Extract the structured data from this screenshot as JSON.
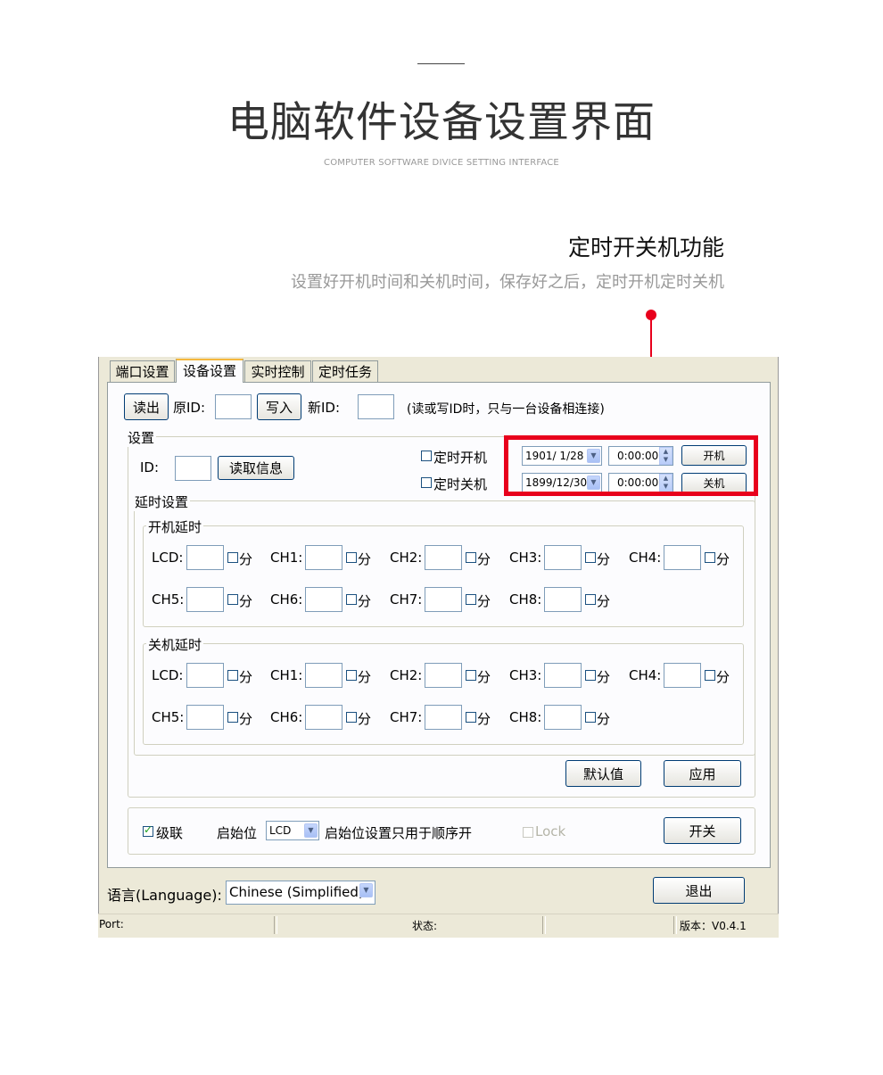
{
  "page": {
    "title": "电脑软件设备设置界面",
    "subtitle": "COMPUTER SOFTWARE DIVICE SETTING INTERFACE",
    "feature_title": "定时开关机功能",
    "feature_desc": "设置好开机时间和关机时间，保存好之后，定时开机定时关机"
  },
  "colors": {
    "highlight": "#e8001c",
    "window_bg": "#ece9d8",
    "panel_bg": "#fcfcfe",
    "tab_accent": "#f5b83d"
  },
  "tabs": [
    {
      "label": "端口设置"
    },
    {
      "label": "设备设置"
    },
    {
      "label": "实时控制"
    },
    {
      "label": "定时任务"
    }
  ],
  "id_row": {
    "read_button": "读出",
    "orig_id_label": "原ID:",
    "write_button": "写入",
    "new_id_label": "新ID:",
    "hint": "(读或写ID时，只与一台设备相连接)"
  },
  "settings": {
    "group_title": "设置",
    "id_label": "ID:",
    "read_info_button": "读取信息",
    "timer_on_label": "定时开机",
    "timer_off_label": "定时关机",
    "timer_on_date": "1901/ 1/28",
    "timer_on_time": "0:00:00",
    "timer_off_date": "1899/12/30",
    "timer_off_time": "0:00:00",
    "power_on_button": "开机",
    "power_off_button": "关机"
  },
  "delay": {
    "group_title": "延时设置",
    "on_title": "开机延时",
    "off_title": "关机延时",
    "unit": "分",
    "row1": [
      "LCD:",
      "CH1:",
      "CH2:",
      "CH3:",
      "CH4:"
    ],
    "row2": [
      "CH5:",
      "CH6:",
      "CH7:",
      "CH8:"
    ],
    "default_button": "默认值",
    "apply_button": "应用"
  },
  "cascade": {
    "cascade_label": "级联",
    "start_label": "启始位",
    "start_value": "LCD",
    "start_hint": "启始位设置只用于顺序开",
    "lock_label": "Lock",
    "switch_button": "开关"
  },
  "language": {
    "label": "语言(Language):",
    "value": "Chinese (Simplified)",
    "exit_button": "退出"
  },
  "statusbar": {
    "port": "Port:",
    "status": "状态:",
    "version": "版本：V0.4.1"
  },
  "icons": {
    "dropdown": "chevron-down-icon",
    "spinner": "spin-arrows-icon",
    "checkbox": "checkbox-icon"
  }
}
